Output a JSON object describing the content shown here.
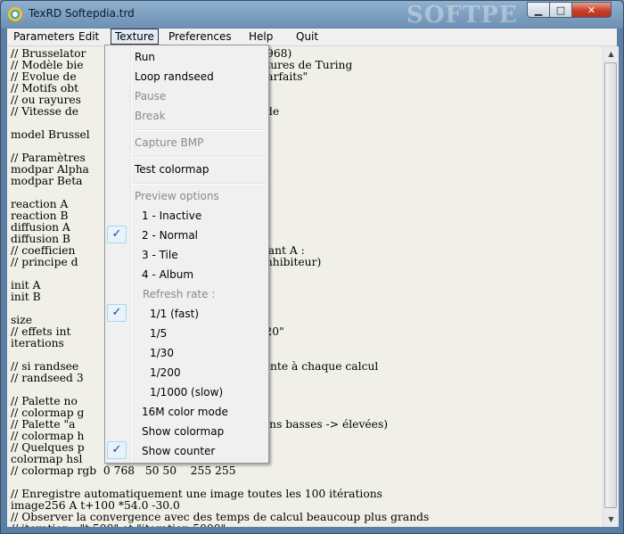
{
  "window": {
    "title": "TexRD Softepdia.trd",
    "watermark": "SOFTPE"
  },
  "titlebar_buttons": {
    "minimize": "▁",
    "maximize": "□",
    "close": "✕"
  },
  "menubar": [
    "Parameters",
    "Edit",
    "Texture",
    "Preferences",
    "Help",
    "Quit"
  ],
  "editor": {
    "lines": [
      "// Brusselator                       J.Chem.Phys.48, 1968)",
      "// Modèle bie                         produit des structures de Turing",
      "// Evolue de                          vers des motifs \"parfaits\"",
      "// Motifs obt                         ement espacés",
      "// ou rayures                         sselator2.trd)",
      "// Vitesse de                         5.3 Mpixels/seconde",
      "",
      "model Brussel",
      "",
      "// Paramètres",
      "modpar Alpha",
      "modpar Beta",
      "",
      "reaction A",
      "reaction B",
      "diffusion A",
      "diffusion B",
      "// coefficien                         ble pour le composant A :",
      "// principe d                         (A: activateur, B: inhibiteur)",
      "",
      "init A",
      "init B",
      "",
      "size",
      "// effets int                         que avec \"size 300 20\"",
      "iterations",
      "",
      "// si randsee                         une texture différente à chaque calcul",
      "// randseed 3",
      "",
      "// Palette no",
      "// colormap g",
      "// Palette \"a                         uge = concentrations basses -> élevées)",
      "// colormap h                         255 255",
      "// Quelques p",
      "colormap hsl                          12",
      "// colormap rgb  0 768   50 50    255 255",
      "",
      "// Enregistre automatiquement une image toutes les 100 itérations",
      "image256 A t+100 *54.0 -30.0",
      "// Observer la convergence avec des temps de calcul beaucoup plus grands",
      "// iteration   \"t 500\" et \"iteration 5000\""
    ]
  },
  "texture_menu": {
    "run": "Run",
    "loop_randseed": "Loop randseed",
    "pause": "Pause",
    "break": "Break",
    "capture_bmp": "Capture BMP",
    "test_colormap": "Test colormap",
    "preview_options": "Preview options",
    "preview_inactive": "1 - Inactive",
    "preview_normal": "2 - Normal",
    "preview_tile": "3 - Tile",
    "preview_album": "4 - Album",
    "refresh_rate": "Refresh rate :",
    "rate_fast": "1/1 (fast)",
    "rate_5": "1/5",
    "rate_30": "1/30",
    "rate_200": "1/200",
    "rate_slow": "1/1000 (slow)",
    "color_mode": "16M color mode",
    "show_colormap": "Show colormap",
    "show_counter": "Show counter",
    "check_glyph": "✓"
  },
  "scrollbar": {
    "up": "▲",
    "down": "▼"
  }
}
